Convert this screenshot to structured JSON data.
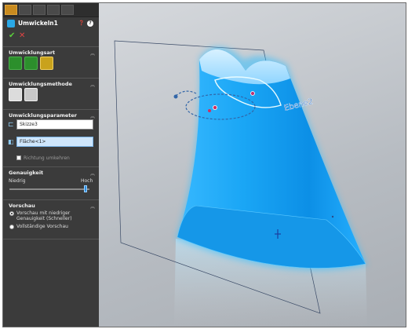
{
  "feature": {
    "title": "Umwickeln1"
  },
  "sections": {
    "wrap_type": {
      "title": "Umwicklungsart"
    },
    "wrap_method": {
      "title": "Umwicklungsmethode"
    },
    "wrap_params": {
      "title": "Umwicklungsparameter",
      "sketch_value": "Skizze3",
      "face_value": "Fläche<1>",
      "reverse_label": "Richtung umkehren"
    },
    "accuracy": {
      "title": "Genauigkeit",
      "low_label": "Niedrig",
      "high_label": "Hoch",
      "level": 0.95
    },
    "preview": {
      "title": "Vorschau",
      "option1": "Vorschau mit niedriger Genauigkeit (Schneller)",
      "option2": "Vollständige Vorschau"
    }
  },
  "viewport": {
    "plane_label": "Ebene2"
  },
  "colors": {
    "body_blue": "#1aa6f5",
    "check": "#5bcf3c",
    "cancel": "#e04444"
  },
  "icons": [
    "cursor-icon",
    "feature-tree-icon",
    "property-manager-icon",
    "config-icon",
    "display-icon",
    "help-icon",
    "info-icon"
  ]
}
